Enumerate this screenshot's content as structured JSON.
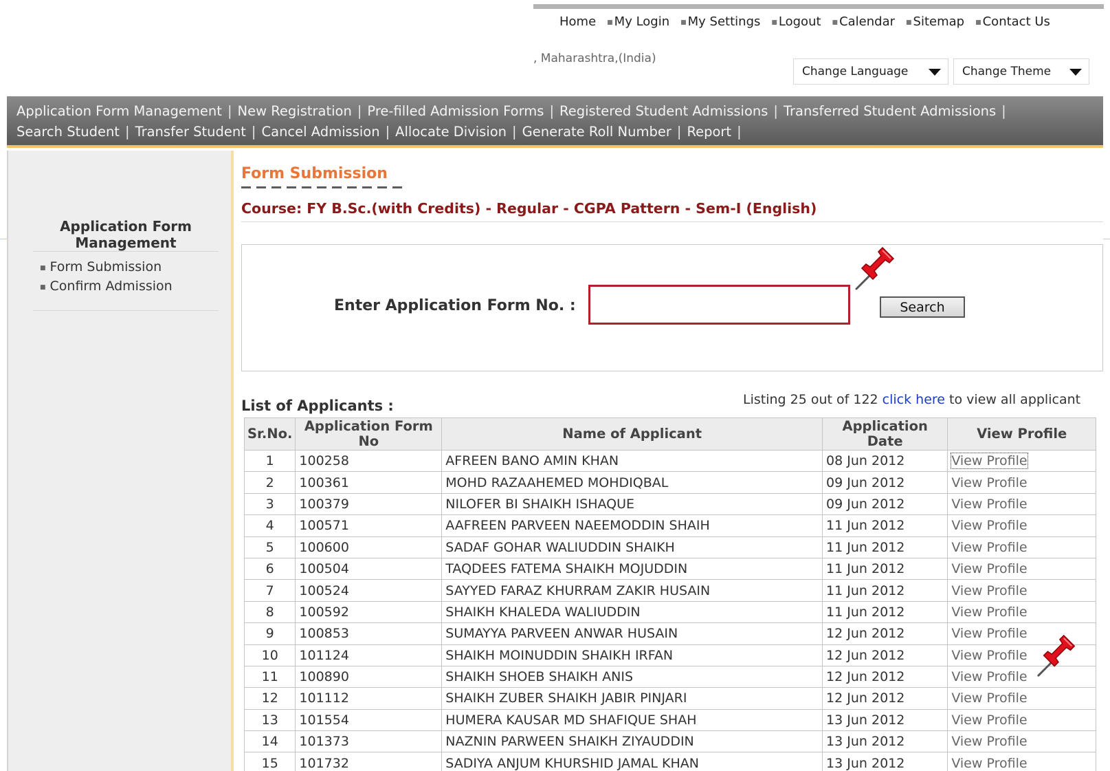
{
  "top_nav": {
    "items": [
      {
        "label": "Home",
        "bullet": false
      },
      {
        "label": "My Login",
        "bullet": true
      },
      {
        "label": "My Settings",
        "bullet": true
      },
      {
        "label": "Logout",
        "bullet": true
      },
      {
        "label": "Calendar",
        "bullet": true
      },
      {
        "label": "Sitemap",
        "bullet": true
      },
      {
        "label": "Contact Us",
        "bullet": true
      }
    ]
  },
  "location": ", Maharashtra,(India)",
  "selects": {
    "language": "Change Language",
    "theme": "Change Theme"
  },
  "menu": {
    "row1": [
      "Application Form Management",
      "New Registration",
      "Pre-filled Admission Forms",
      "Registered Student Admissions",
      "Transferred Student Admissions"
    ],
    "row2": [
      "Search Student",
      "Transfer Student",
      "Cancel Admission",
      "Allocate Division",
      "Generate Roll Number",
      "Report"
    ]
  },
  "sidebar": {
    "title_line1": "Application Form",
    "title_line2": "Management",
    "links": [
      "Form Submission",
      "Confirm Admission"
    ]
  },
  "content": {
    "page_title": "Form Submission",
    "course": "Course: FY B.Sc.(with Credits) - Regular - CGPA Pattern - Sem-I (English)",
    "search_label": "Enter Application Form No. :",
    "search_value": "",
    "search_button": "Search",
    "list_title": "List of Applicants :",
    "listing_prefix": "Listing 25 out of 122 ",
    "listing_link": "click here",
    "listing_suffix": " to view all applicant"
  },
  "table": {
    "headers": [
      "Sr.No.",
      "Application Form No",
      "Name of Applicant",
      "Application Date",
      "View Profile"
    ],
    "rows": [
      [
        "1",
        "100258",
        "AFREEN BANO AMIN KHAN",
        "08 Jun 2012",
        "View Profile"
      ],
      [
        "2",
        "100361",
        "MOHD RAZAAHEMED MOHDIQBAL",
        "09 Jun 2012",
        "View Profile"
      ],
      [
        "3",
        "100379",
        "NILOFER BI SHAIKH ISHAQUE",
        "09 Jun 2012",
        "View Profile"
      ],
      [
        "4",
        "100571",
        "AAFREEN PARVEEN NAEEMODDIN SHAIH",
        "11 Jun 2012",
        "View Profile"
      ],
      [
        "5",
        "100600",
        "SADAF GOHAR WALIUDDIN SHAIKH",
        "11 Jun 2012",
        "View Profile"
      ],
      [
        "6",
        "100504",
        "TAQDEES FATEMA SHAIKH MOJUDDIN",
        "11 Jun 2012",
        "View Profile"
      ],
      [
        "7",
        "100524",
        "SAYYED FARAZ KHURRAM ZAKIR HUSAIN",
        "11 Jun 2012",
        "View Profile"
      ],
      [
        "8",
        "100592",
        "SHAIKH KHALEDA WALIUDDIN",
        "11 Jun 2012",
        "View Profile"
      ],
      [
        "9",
        "100853",
        "SUMAYYA PARVEEN ANWAR HUSAIN",
        "12 Jun 2012",
        "View Profile"
      ],
      [
        "10",
        "101124",
        "SHAIKH MOINUDDIN SHAIKH IRFAN",
        "12 Jun 2012",
        "View Profile"
      ],
      [
        "11",
        "100890",
        "SHAIKH SHOEB SHAIKH ANIS",
        "12 Jun 2012",
        "View Profile"
      ],
      [
        "12",
        "101112",
        "SHAIKH ZUBER SHAIKH JABIR PINJARI",
        "12 Jun 2012",
        "View Profile"
      ],
      [
        "13",
        "101554",
        "HUMERA KAUSAR MD SHAFIQUE SHAH",
        "13 Jun 2012",
        "View Profile"
      ],
      [
        "14",
        "101373",
        "NAZNIN PARWEEN SHAIKH ZIYAUDDIN",
        "13 Jun 2012",
        "View Profile"
      ],
      [
        "15",
        "101732",
        "SADIYA ANJUM KHURSHID JAMAL KHAN",
        "13 Jun 2012",
        "View Profile"
      ]
    ]
  },
  "colors": {
    "accent_orange": "#e8763a",
    "course_maroon": "#8b1a1a",
    "input_border": "#b3202a",
    "link_blue": "#1a3cc8",
    "menu_underline": "#f1c46b"
  },
  "icons": [
    "pushpin-icon",
    "dropdown-arrow-icon"
  ]
}
